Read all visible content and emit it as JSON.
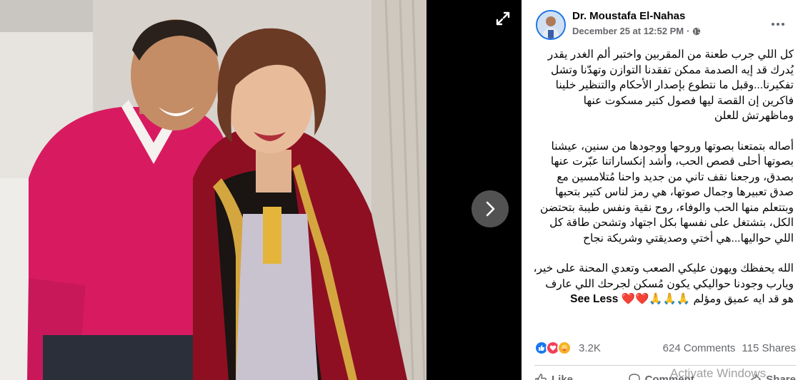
{
  "post": {
    "author": "Dr. Moustafa El-Nahas",
    "date": "December 25 at 12:52 PM",
    "separator": "·",
    "privacy_icon": "globe-icon",
    "paragraphs": [
      "كل اللي جرب طعنة من المقربين واختبر ألم الغدر يقدر يُدرك قد إيه الصدمة ممكن تفقدنا التوازن وتهدّنا وتشل تفكيرنا...وقبل ما نتطوع بإصدار الأحكام والتنظير خلينا فاكرين إن القصة ليها فصول كتير مسكوت عنها وماظهرتش للعلن",
      "أصاله بتمتعنا بصوتها وروحها ووجودها من سنين، عيشنا بصوتها أحلى قصص الحب، وأشد إنكساراتنا عبّرت عنها بصدق، ورجعنا نقف تاني من جديد واحنا مُتلامسين مع صدق تعبيرها وجمال صوتها، هي رمز لناس كتير بتحبها وبتتعلم منها الحب والوفاء، روح نقية ونفس طيبة بتحتضن الكل، بتشتغل على نفسها بكل اجتهاد وتشحن طاقة كل اللي حواليها...هي أختي وصديقتي وشريكة نجاح"
    ],
    "last_paragraph": "الله يحفظك ويهون عليكي الصعب وتعدي المحنة على خير، ويارب وجودنا حواليكي يكون مُسكن لجرحك اللي عارف هو قد ايه عميق ومؤلم",
    "last_emojis": "🙏🙏🙏",
    "last_hearts": "❤️❤️",
    "see_less": "See Less"
  },
  "reactions": {
    "icons": [
      "like-icon",
      "love-icon",
      "care-icon"
    ],
    "count": "3.2K",
    "comments": "624 Comments",
    "shares": "115 Shares"
  },
  "actions": {
    "like": "Like",
    "comment": "Comment",
    "share": "Share"
  },
  "viewer": {
    "expand_icon": "expand-icon",
    "next_icon": "chevron-right-icon"
  },
  "watermark": "Activate Windows",
  "colors": {
    "accent": "#1b74e4",
    "like_blue": "#1877f2",
    "love_red": "#f33e58",
    "care_yellow": "#f7b125",
    "text_secondary": "#65676b"
  }
}
